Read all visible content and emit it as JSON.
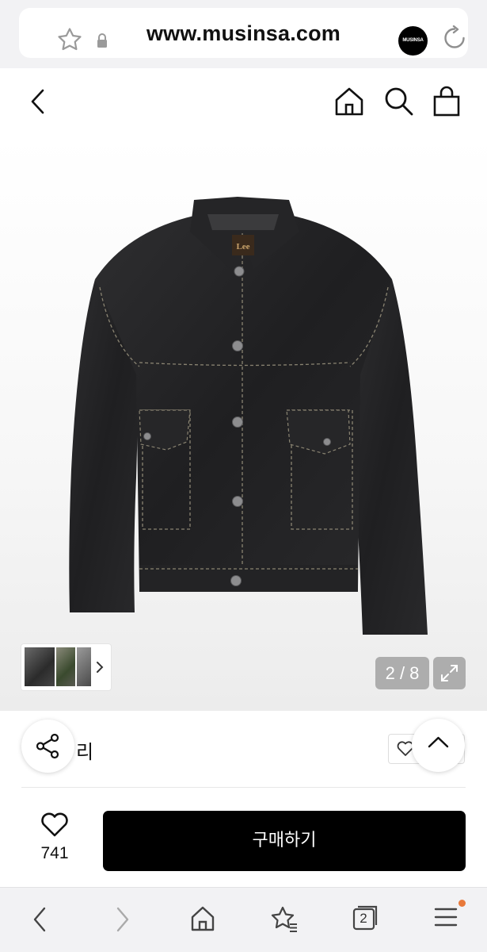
{
  "browser": {
    "url": "www.musinsa.com",
    "site_logo_text": "MUSINSA",
    "icons": [
      "star-icon",
      "lock-icon",
      "reload-icon"
    ]
  },
  "header": {
    "icons": [
      "back-arrow-icon",
      "home-icon",
      "search-icon",
      "shopping-bag-icon"
    ]
  },
  "gallery": {
    "brand_label": "Lee",
    "counter": "2 / 8",
    "current_index": 2,
    "total": 8
  },
  "info": {
    "partial_text": "리"
  },
  "buy_bar": {
    "like_count": "741",
    "buy_label": "구매하기"
  },
  "toolbar": {
    "tabs_count": "2",
    "notification_color": "#e8793a"
  },
  "colors": {
    "buy_button": "#000000",
    "background": "#f2f2f4"
  }
}
